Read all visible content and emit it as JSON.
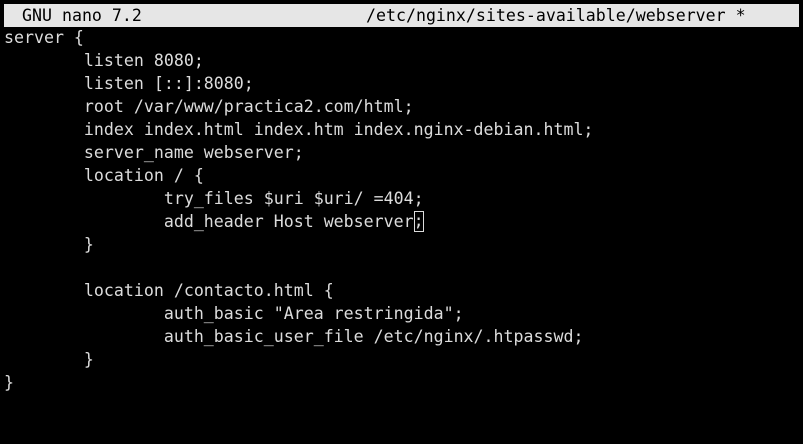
{
  "window": {
    "app_title": "GNU nano 7.2",
    "file_path": "/etc/nginx/sites-available/webserver *"
  },
  "editor": {
    "lines": [
      "server {",
      "        listen 8080;",
      "        listen [::]:8080;",
      "        root /var/www/practica2.com/html;",
      "        index index.html index.htm index.nginx-debian.html;",
      "        server_name webserver;",
      "        location / {",
      "                try_files $uri $uri/ =404;",
      "                add_header Host webserver",
      "        }",
      "",
      "        location /contacto.html {",
      "                auth_basic \"Area restringida\";",
      "                auth_basic_user_file /etc/nginx/.htpasswd;",
      "        }",
      "}"
    ],
    "cursor_char": ";"
  },
  "colors": {
    "background": "#000000",
    "text": "#dcdcdc",
    "titlebar_bg": "#e6e6e6",
    "titlebar_text": "#000000"
  }
}
